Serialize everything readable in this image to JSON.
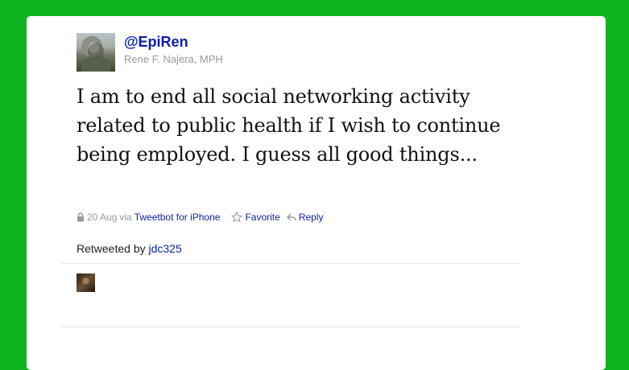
{
  "tweet": {
    "handle": "@EpiRen",
    "full_name": "Rene F. Najera, MPH",
    "text": "I am to end all social networking activity related to public health if I wish to continue being employed. I guess all good things...",
    "date": "20 Aug",
    "via_label": "via",
    "source": "Tweetbot for iPhone",
    "protected_icon": "lock-icon"
  },
  "actions": {
    "favorite": "Favorite",
    "reply": "Reply"
  },
  "retweet": {
    "label": "Retweeted by",
    "user": "jdc325"
  },
  "colors": {
    "background": "#0fb51f",
    "link": "#0a1fa8",
    "meta": "#999999"
  }
}
